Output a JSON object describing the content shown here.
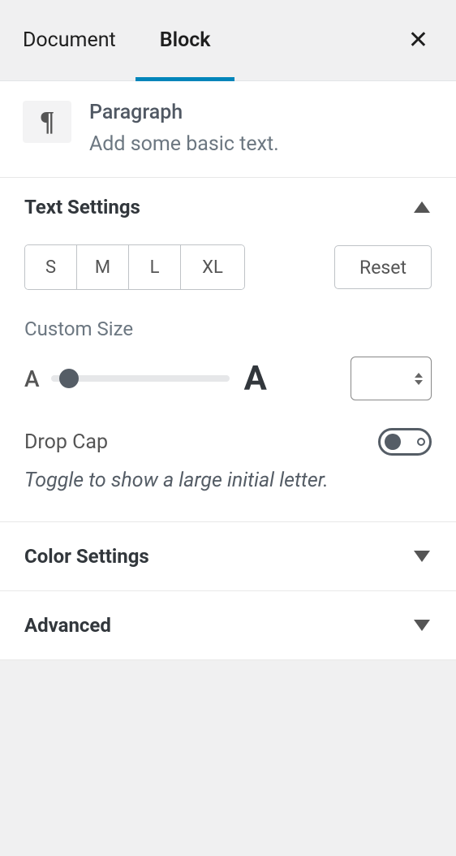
{
  "tabs": {
    "document": "Document",
    "block": "Block",
    "active": "block"
  },
  "block": {
    "icon": "paragraph-icon",
    "title": "Paragraph",
    "description": "Add some basic text."
  },
  "text_settings": {
    "title": "Text Settings",
    "expanded": true,
    "size_buttons": [
      "S",
      "M",
      "L",
      "XL"
    ],
    "reset_label": "Reset",
    "custom_size_label": "Custom Size",
    "custom_size_value": "",
    "dropcap_label": "Drop Cap",
    "dropcap_on": false,
    "dropcap_hint": "Toggle to show a large initial letter."
  },
  "color_settings": {
    "title": "Color Settings",
    "expanded": false
  },
  "advanced": {
    "title": "Advanced",
    "expanded": false
  },
  "colors": {
    "accent": "#0085ba",
    "text": "#32373c",
    "muted": "#6c7781",
    "border": "#e2e4e7"
  }
}
